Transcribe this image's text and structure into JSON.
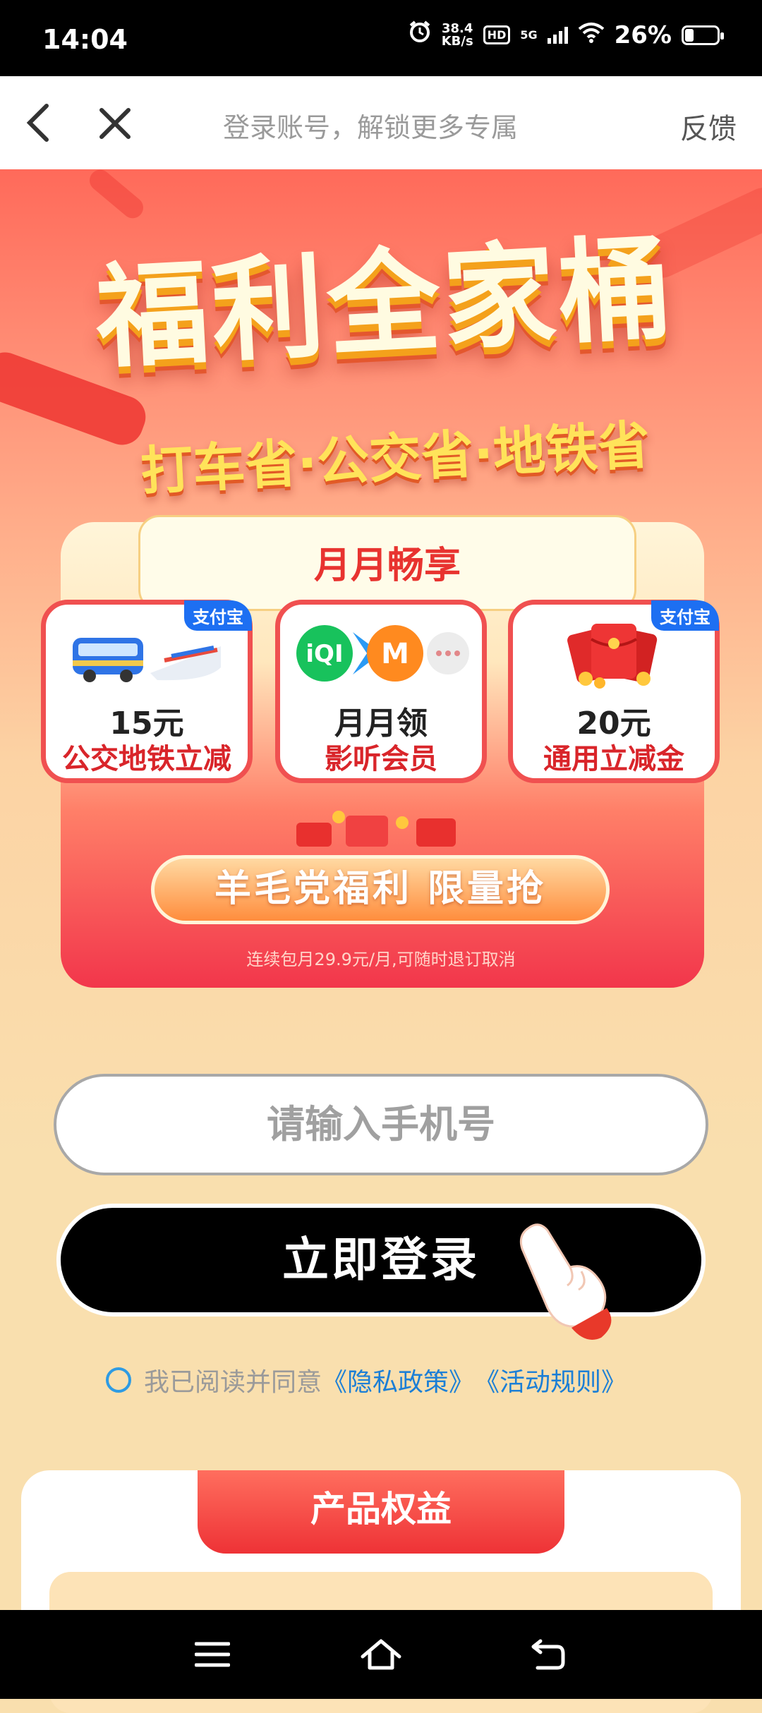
{
  "status_bar": {
    "time": "14:04",
    "net_speed_value": "38.4",
    "net_speed_unit": "KB/s",
    "hd": "HD",
    "network": "5G",
    "battery": "26%"
  },
  "nav": {
    "title": "登录账号，解锁更多专属",
    "feedback": "反馈"
  },
  "hero": {
    "title": "福利全家桶",
    "subtitle": "打车省·公交省·地铁省"
  },
  "benefits": {
    "header": "月月畅享",
    "tiles": [
      {
        "badge": "支付宝",
        "line1": "15元",
        "line2": "公交地铁立减"
      },
      {
        "line1": "月月领",
        "line2": "影听会员"
      },
      {
        "badge": "支付宝",
        "line1": "20元",
        "line2": "通用立减金"
      }
    ],
    "cta": "羊毛党福利 限量抢",
    "fine_print": "连续包月29.9元/月,可随时退订取消"
  },
  "login": {
    "phone_placeholder": "请输入手机号",
    "button": "立即登录",
    "agreement_prefix": "我已阅读并同意",
    "privacy_link": "《隐私政策》",
    "rules_link": "《活动规则》"
  },
  "product": {
    "tab": "产品权益"
  },
  "colors": {
    "accent_red": "#e8332f",
    "link_blue": "#1c7fd6",
    "badge_blue": "#1d6ff2"
  }
}
